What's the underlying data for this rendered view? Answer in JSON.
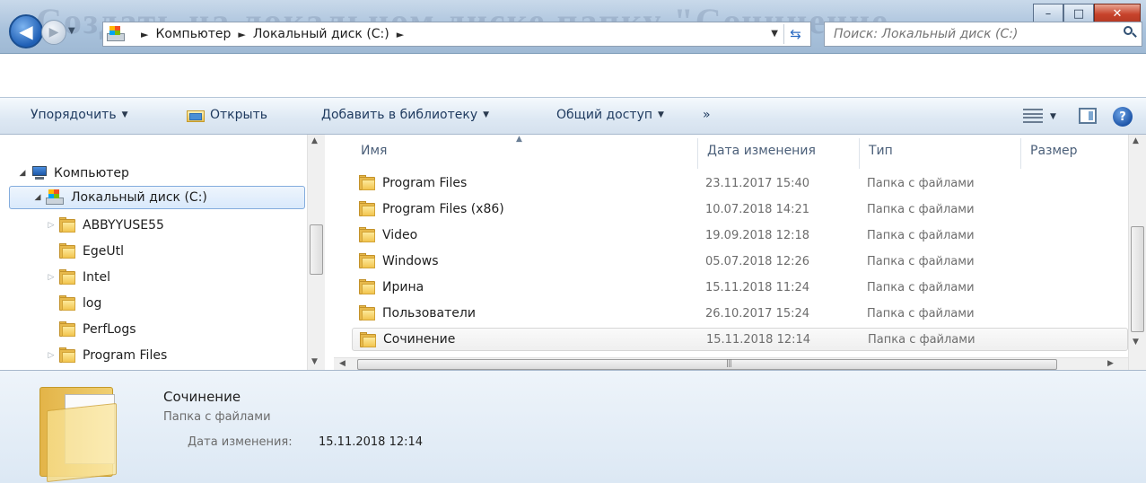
{
  "title_background_text": "Создать на локальном диске папку \"Сочинение",
  "window_buttons": {
    "minimize": "–",
    "maximize": "□",
    "close": "✕"
  },
  "address": {
    "crumbs": [
      "Компьютер",
      "Локальный диск (C:)"
    ],
    "separator": "►"
  },
  "search": {
    "placeholder": "Поиск: Локальный диск (C:)"
  },
  "toolbar": {
    "organize": "Упорядочить",
    "open": "Открыть",
    "add_to_library": "Добавить в библиотеку",
    "share": "Общий доступ",
    "more": "»"
  },
  "nav_tree": {
    "computer": "Компьютер",
    "drive": "Локальный диск (C:)",
    "folders": [
      "ABBYYUSE55",
      "EgeUtl",
      "Intel",
      "log",
      "PerfLogs",
      "Program Files"
    ]
  },
  "columns": {
    "name": "Имя",
    "date": "Дата изменения",
    "type": "Тип",
    "size": "Размер"
  },
  "files": [
    {
      "name": "Program Files",
      "date": "23.11.2017 15:40",
      "type": "Папка с файлами"
    },
    {
      "name": "Program Files (x86)",
      "date": "10.07.2018 14:21",
      "type": "Папка с файлами"
    },
    {
      "name": "Video",
      "date": "19.09.2018 12:18",
      "type": "Папка с файлами"
    },
    {
      "name": "Windows",
      "date": "05.07.2018 12:26",
      "type": "Папка с файлами"
    },
    {
      "name": "Ирина",
      "date": "15.11.2018 11:24",
      "type": "Папка с файлами"
    },
    {
      "name": "Пользователи",
      "date": "26.10.2017 15:24",
      "type": "Папка с файлами"
    },
    {
      "name": "Сочинение",
      "date": "15.11.2018 12:14",
      "type": "Папка с файлами"
    }
  ],
  "details": {
    "name": "Сочинение",
    "type": "Папка с файлами",
    "date_label": "Дата изменения:",
    "date_value": "15.11.2018 12:14"
  }
}
